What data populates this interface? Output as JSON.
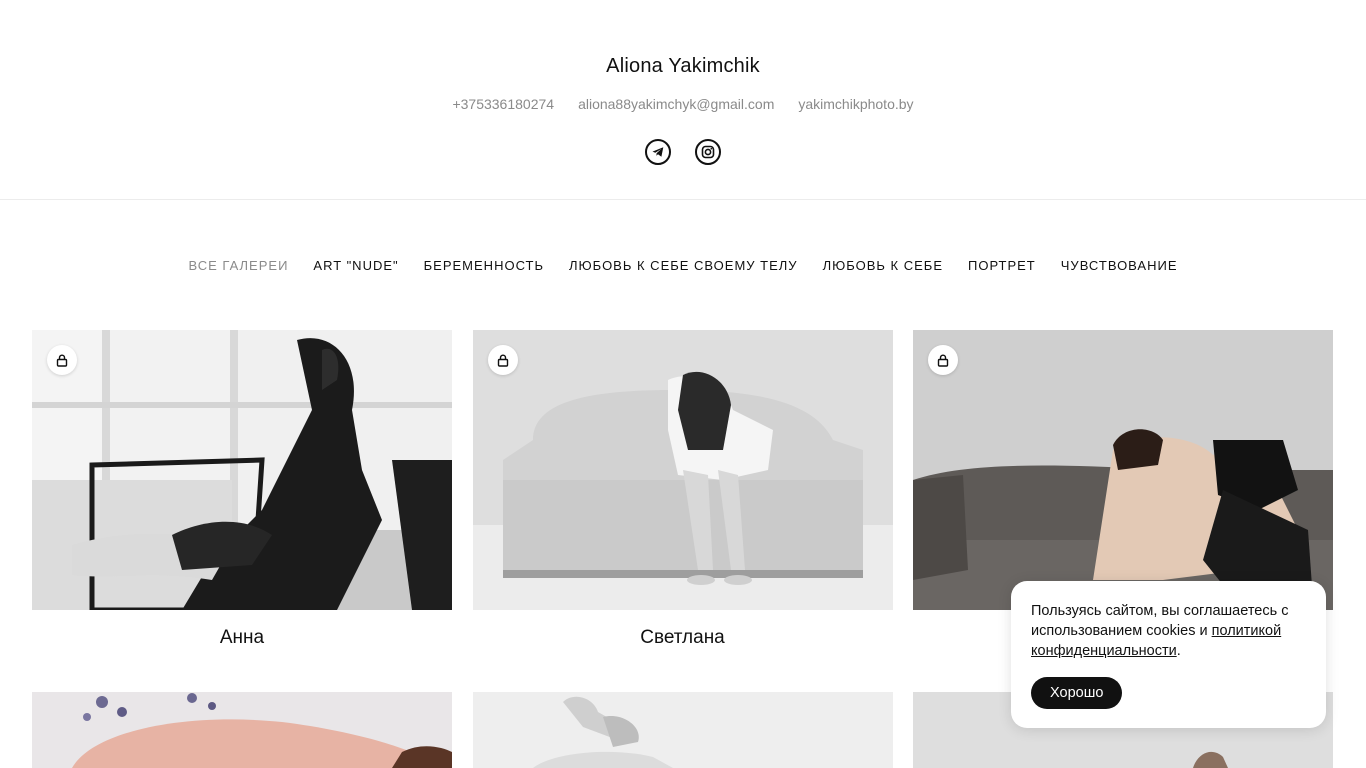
{
  "header": {
    "title": "Aliona Yakimchik",
    "contacts": {
      "phone": "+375336180274",
      "email": "aliona88yakimchyk@gmail.com",
      "website": "yakimchikphoto.by"
    },
    "socials": [
      "telegram-icon",
      "instagram-icon"
    ]
  },
  "nav": {
    "items": [
      {
        "label": "ВСЕ ГАЛЕРЕИ",
        "active": true
      },
      {
        "label": "ART \"NUDE\"",
        "active": false
      },
      {
        "label": "БЕРЕМЕННОСТЬ",
        "active": false
      },
      {
        "label": "ЛЮБОВЬ К СЕБЕ СВОЕМУ ТЕЛУ",
        "active": false
      },
      {
        "label": "ЛЮБОВЬ К СЕБЕ",
        "active": false
      },
      {
        "label": "ПОРТРЕТ",
        "active": false
      },
      {
        "label": "ЧУВСТВОВАНИЕ",
        "active": false
      }
    ]
  },
  "galleries": {
    "row1": [
      {
        "title": "Анна",
        "locked": true
      },
      {
        "title": "Светлана",
        "locked": true
      },
      {
        "title": "",
        "locked": true
      }
    ]
  },
  "cookie": {
    "text": "Пользуясь сайтом, вы соглашаетесь с использованием cookies и ",
    "link": "политикой конфиденциальности",
    "suffix": ".",
    "button": "Хорошо"
  },
  "colors": {
    "accent": "#111111",
    "muted": "#8a8a8a",
    "border": "#ececec"
  }
}
